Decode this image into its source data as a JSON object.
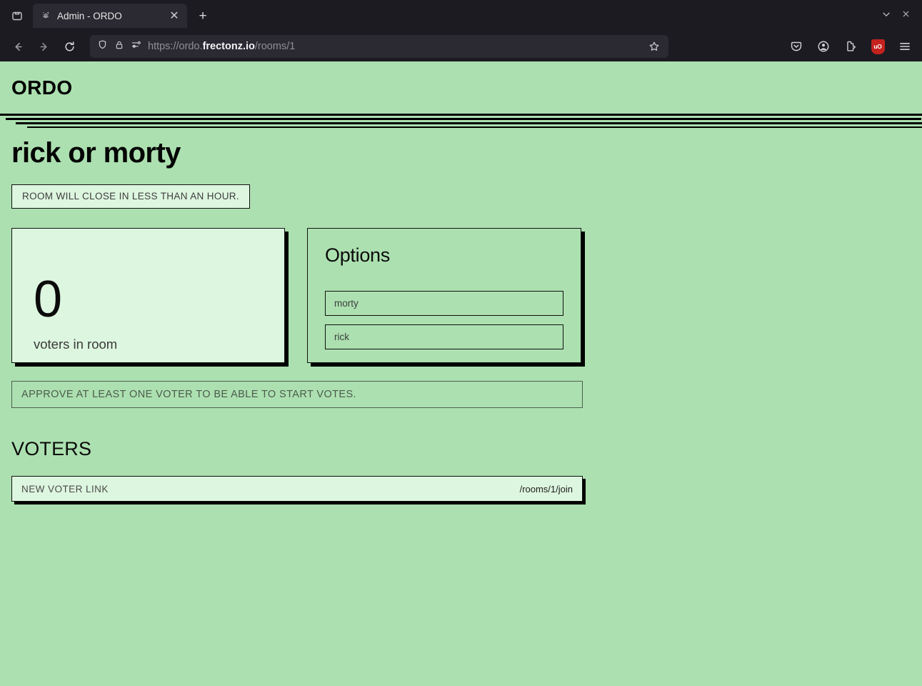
{
  "browser": {
    "tab": {
      "title": "Admin - ORDO",
      "favicon": "site-favicon",
      "close_label": "✕"
    },
    "newtab_label": "+",
    "list_all_tabs_label": "∨",
    "window_close_label": "✕",
    "nav": {
      "back_label": "←",
      "forward_label": "→",
      "reload_label": "↻"
    },
    "url": {
      "scheme": "https://ordo.",
      "domain": "frectonz.io",
      "path": "/rooms/1",
      "full": "https://ordo.frectonz.io/rooms/1"
    },
    "toolbar": {
      "pocket_label": "save-to-pocket",
      "account_label": "account",
      "extensions_label": "extensions",
      "ublock_label": "uO",
      "menu_label": "☰"
    }
  },
  "site": {
    "brand": "ORDO"
  },
  "room": {
    "title": "rick or morty",
    "notice": "ROOM WILL CLOSE IN LESS THAN AN HOUR.",
    "voters": {
      "count": "0",
      "label": "voters in room"
    },
    "options": {
      "heading": "Options",
      "items": [
        {
          "label": "morty"
        },
        {
          "label": "rick"
        }
      ]
    },
    "start_votes_hint": "APPROVE AT LEAST ONE VOTER TO BE ABLE TO START VOTES.",
    "voters_section": {
      "heading": "VOTERS",
      "new_voter_link": {
        "label": "NEW VOTER LINK",
        "value": "/rooms/1/join"
      }
    }
  },
  "colors": {
    "page_bg": "#ace0b0",
    "card_bg": "#ddf6df",
    "ink": "#000000",
    "chrome_bg": "#1c1b22",
    "chrome_field": "#2b2a33",
    "ublock_red": "#c5221f"
  }
}
